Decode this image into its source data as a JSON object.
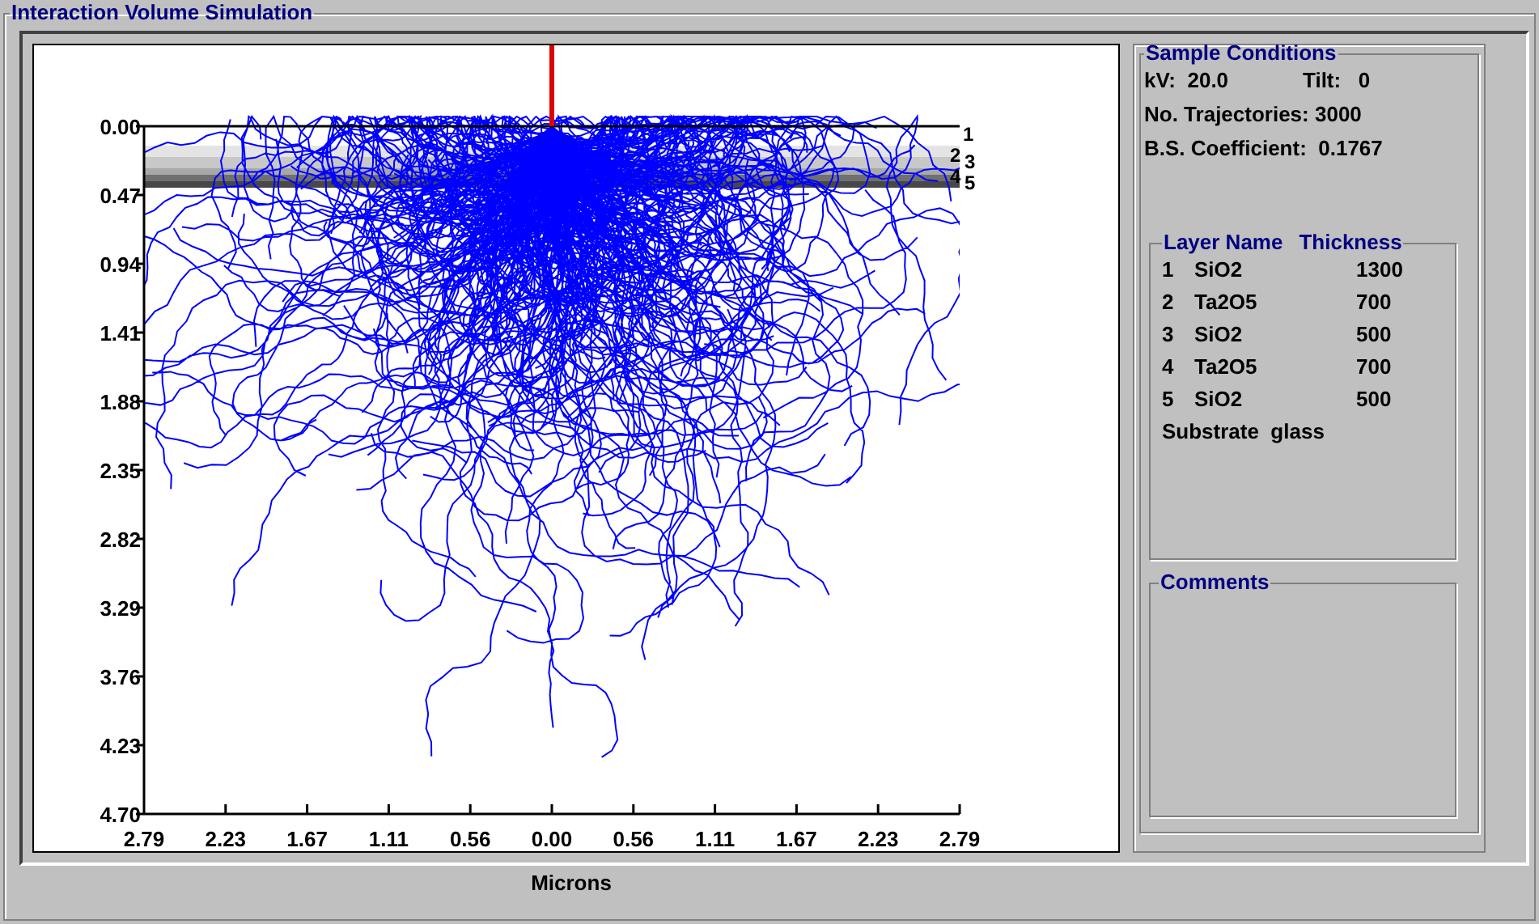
{
  "window": {
    "title": "Interaction Volume Simulation"
  },
  "plot": {
    "y_tick_labels": [
      "0.00",
      "0.47",
      "0.94",
      "1.41",
      "1.88",
      "2.35",
      "2.82",
      "3.29",
      "3.76",
      "4.23",
      "4.70"
    ],
    "x_tick_labels": [
      "2.79",
      "2.23",
      "1.67",
      "1.11",
      "0.56",
      "0.00",
      "0.56",
      "1.11",
      "1.67",
      "2.23",
      "2.79"
    ],
    "layer_markers": [
      "1",
      "2",
      "3",
      "4",
      "5"
    ],
    "x_axis_title": "Microns"
  },
  "sample_conditions": {
    "title": "Sample Conditions",
    "kv": "kV:  20.0",
    "tilt": "Tilt:   0",
    "trajectories": "No. Trajectories: 3000",
    "bs_coefficient": "B.S. Coefficient:  0.1767"
  },
  "layers": {
    "name_heading": "Layer Name",
    "thickness_heading": "Thickness",
    "rows": [
      {
        "number": "1",
        "name": "SiO2",
        "thickness": "1300"
      },
      {
        "number": "2",
        "name": "Ta2O5",
        "thickness": "700"
      },
      {
        "number": "3",
        "name": "SiO2",
        "thickness": "500"
      },
      {
        "number": "4",
        "name": "Ta2O5",
        "thickness": "700"
      },
      {
        "number": "5",
        "name": "SiO2",
        "thickness": "500"
      }
    ],
    "substrate": "Substrate  glass"
  },
  "comments": {
    "title": "Comments"
  }
}
